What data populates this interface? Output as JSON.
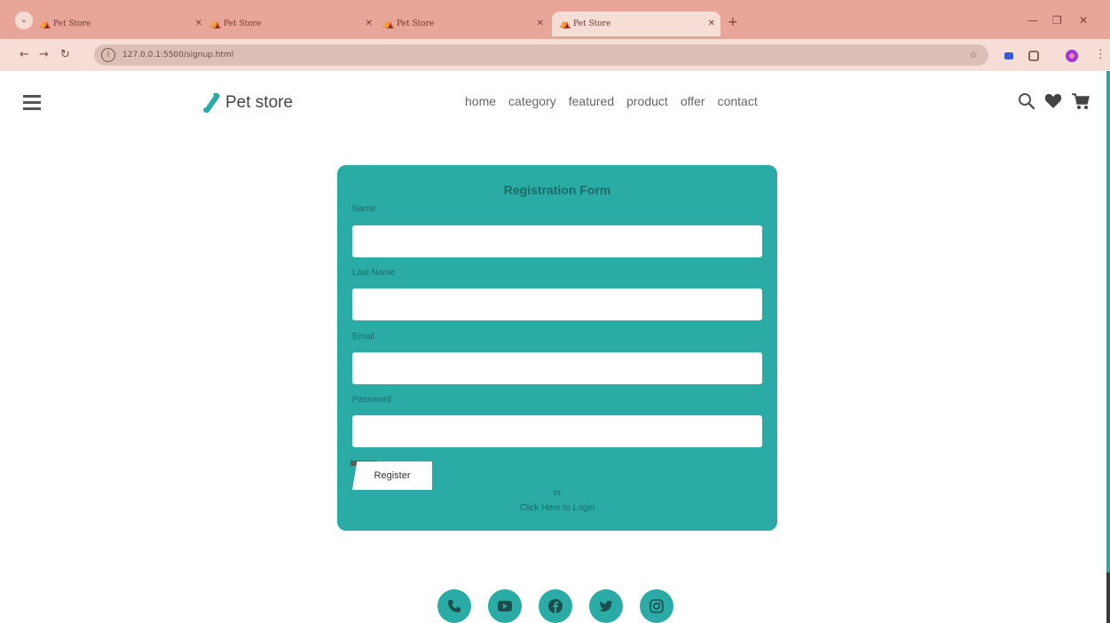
{
  "browser": {
    "tabs": [
      {
        "title": "Pet Store",
        "active": false
      },
      {
        "title": "Pet Store",
        "active": false
      },
      {
        "title": "Pet Store",
        "active": false
      },
      {
        "title": "Pet Store",
        "active": true
      }
    ],
    "url": "127.0.0.1:5500/signup.html"
  },
  "site": {
    "logo_text": "Pet store",
    "nav": [
      "home",
      "category",
      "featured",
      "product",
      "offer",
      "contact"
    ]
  },
  "form": {
    "title": "Registration Form",
    "name_label": "Name",
    "lastname_label": "Last Name",
    "email_label": "Email",
    "password_label": "Password",
    "name_value": "",
    "lastname_value": "",
    "email_value": "",
    "password_value": "",
    "register_label": "Register",
    "or_text": "or",
    "login_link": "Click Here to Login"
  },
  "social_icons": [
    "phone-icon",
    "youtube-icon",
    "facebook-icon",
    "twitter-icon",
    "instagram-icon"
  ],
  "colors": {
    "accent": "#2aaba5",
    "tabbar": "#e8a698",
    "addressbar": "#f6ddd6"
  }
}
